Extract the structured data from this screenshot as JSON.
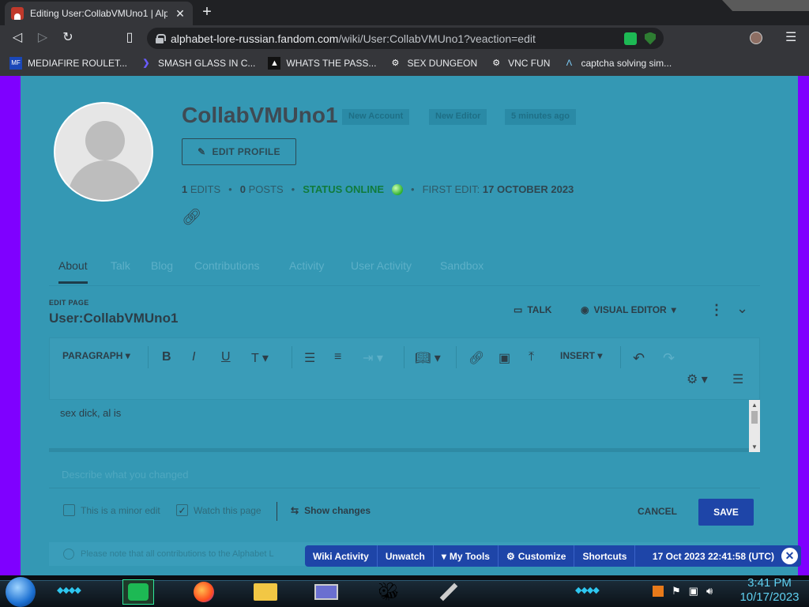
{
  "browser": {
    "tab_title": "Editing User:CollabVMUno1 | Alph",
    "url_domain": "alphabet-lore-russian.fandom.com",
    "url_path": "/wiki/User:CollabVMUno1?veaction=edit"
  },
  "bookmarks": [
    {
      "label": "MEDIAFIRE ROULET...",
      "icon": "mediafire-icon"
    },
    {
      "label": "SMASH GLASS IN C...",
      "icon": "chevron-icon"
    },
    {
      "label": "WHATS THE PASS...",
      "icon": "box-icon"
    },
    {
      "label": "SEX DUNGEON",
      "icon": "gear-icon"
    },
    {
      "label": "VNC FUN",
      "icon": "gear-icon"
    },
    {
      "label": "captcha solving sim...",
      "icon": "lambda-icon"
    }
  ],
  "profile": {
    "username": "CollabVMUno1",
    "tags": [
      "New Account",
      "New Editor",
      "5 minutes ago"
    ],
    "edit_profile": "EDIT PROFILE",
    "edits_count": "1",
    "edits_label": "EDITS",
    "posts_count": "0",
    "posts_label": "POSTS",
    "status": "STATUS ONLINE",
    "first_edit_label": "FIRST EDIT:",
    "first_edit_date": "17 OCTOBER 2023"
  },
  "tabs": [
    "About",
    "Talk",
    "Blog",
    "Contributions",
    "Activity",
    "User Activity",
    "Sandbox"
  ],
  "editor": {
    "edit_page_label": "EDIT PAGE",
    "page_title": "User:CollabVMUno1",
    "talk": "TALK",
    "visual_editor": "VISUAL EDITOR",
    "paragraph": "PARAGRAPH",
    "insert": "INSERT",
    "content": "sex dick, al is",
    "summary_placeholder": "Describe what you changed",
    "minor_edit": "This is a minor edit",
    "watch_page": "Watch this page",
    "show_changes": "Show changes",
    "cancel": "CANCEL",
    "save": "SAVE",
    "notice": "Please note that all contributions to the Alphabet L"
  },
  "wikibar": {
    "items": [
      "Wiki Activity",
      "Unwatch",
      "My Tools",
      "Customize",
      "Shortcuts"
    ],
    "timestamp": "17 Oct 2023 22:41:58 (UTC)"
  },
  "taskbar": {
    "time": "3:41 PM",
    "date": "10/17/2023"
  },
  "colors": {
    "overlay": "#3498b4",
    "save_button": "#1e45a8",
    "purple_bg": "#7f00ff"
  }
}
